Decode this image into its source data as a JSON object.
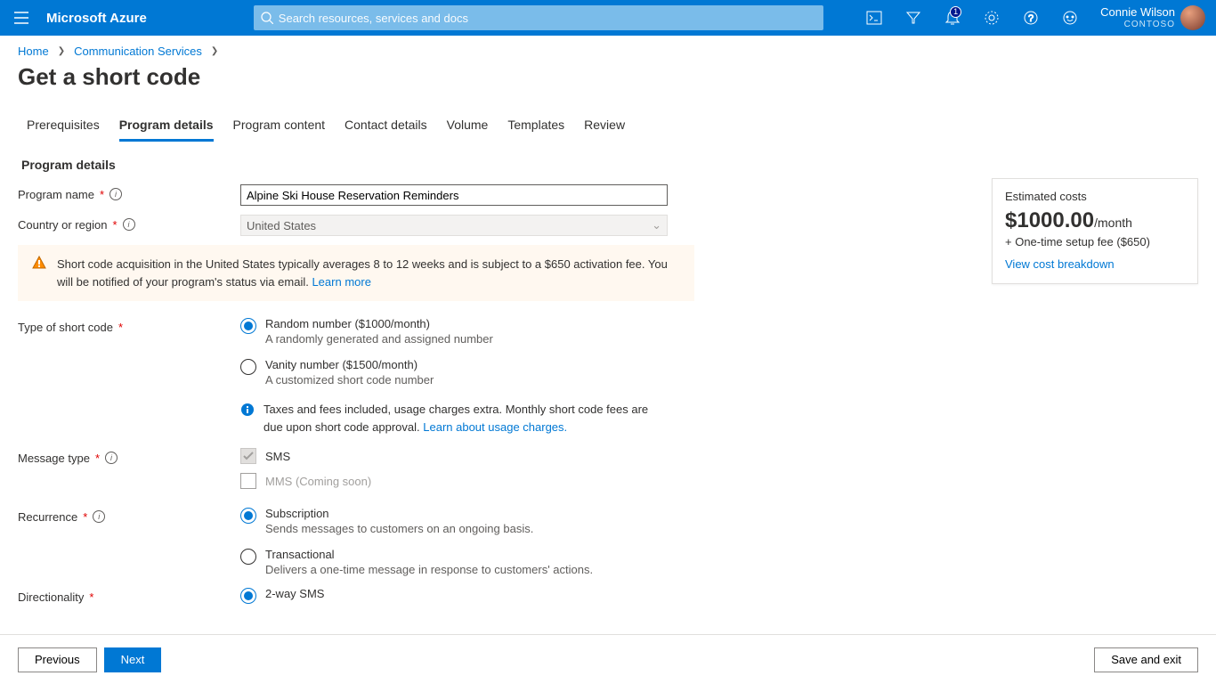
{
  "topbar": {
    "brand": "Microsoft Azure",
    "search_placeholder": "Search resources, services and docs",
    "notif_count": "1",
    "user_name": "Connie Wilson",
    "tenant": "CONTOSO"
  },
  "breadcrumb": {
    "items": [
      "Home",
      "Communication Services"
    ]
  },
  "page_title": "Get a short code",
  "tabs": [
    "Prerequisites",
    "Program details",
    "Program content",
    "Contact details",
    "Volume",
    "Templates",
    "Review"
  ],
  "active_tab": 1,
  "section_title": "Program details",
  "fields": {
    "program_name_label": "Program name",
    "program_name_value": "Alpine Ski House Reservation Reminders",
    "country_label": "Country or region",
    "country_value": "United States",
    "type_label": "Type of short code",
    "msg_type_label": "Message type",
    "recurrence_label": "Recurrence",
    "directionality_label": "Directionality"
  },
  "alert": {
    "text": "Short code acquisition in the United States typically averages 8 to 12 weeks and is subject to a $650 activation fee. You will be notified of your program's status via email. ",
    "link": "Learn more"
  },
  "type_options": [
    {
      "label": "Random number ($1000/month)",
      "desc": "A randomly generated and assigned number",
      "checked": true
    },
    {
      "label": "Vanity number ($1500/month)",
      "desc": "A customized short code number",
      "checked": false
    }
  ],
  "type_info": {
    "text": "Taxes and fees included, usage charges extra. Monthly short code fees are due upon short code approval. ",
    "link": "Learn about usage charges."
  },
  "msg_options": [
    {
      "label": "SMS",
      "checked": true,
      "disabled": true
    },
    {
      "label": "MMS (Coming soon)",
      "checked": false,
      "disabled": true
    }
  ],
  "recurrence_options": [
    {
      "label": "Subscription",
      "desc": "Sends messages to customers on an ongoing basis.",
      "checked": true
    },
    {
      "label": "Transactional",
      "desc": "Delivers a one-time message in response to customers' actions.",
      "checked": false
    }
  ],
  "directionality_options": [
    {
      "label": "2-way SMS",
      "checked": true
    }
  ],
  "costs": {
    "title": "Estimated costs",
    "price": "$1000.00",
    "period": "/month",
    "setup": "+ One-time setup fee ($650)",
    "link": "View cost breakdown"
  },
  "footer": {
    "prev": "Previous",
    "next": "Next",
    "save": "Save and exit"
  }
}
